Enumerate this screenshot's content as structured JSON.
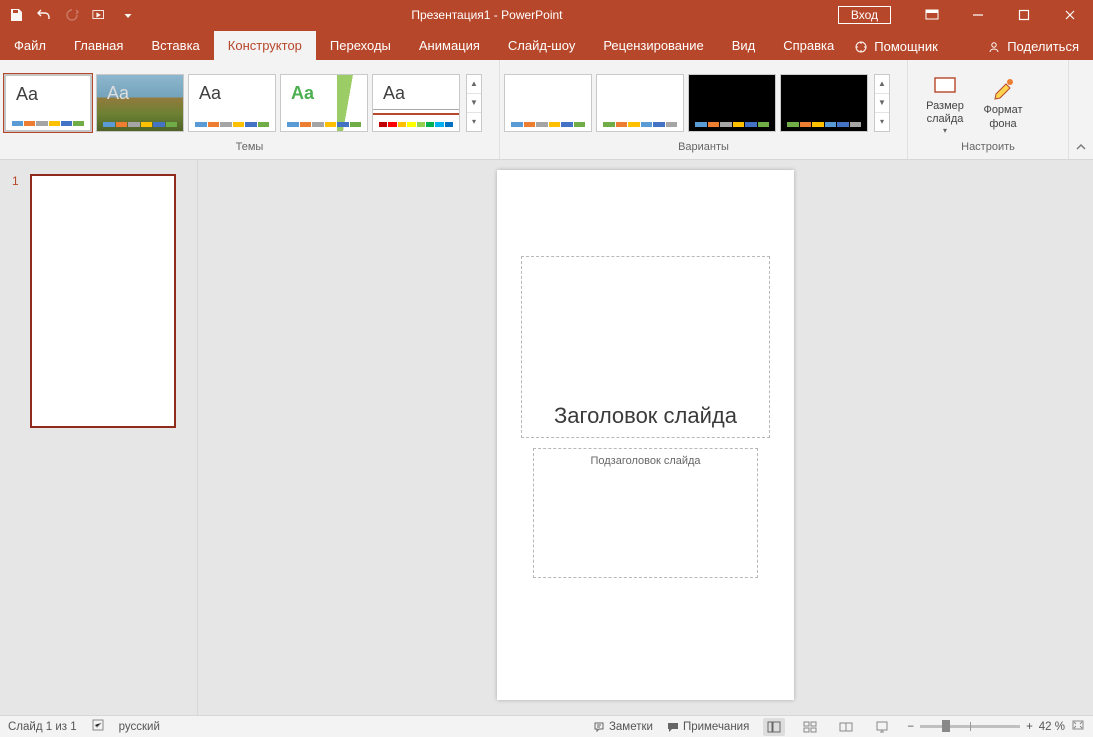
{
  "titlebar": {
    "title": "Презентация1 - PowerPoint",
    "signin": "Вход"
  },
  "tabs": {
    "file": "Файл",
    "home": "Главная",
    "insert": "Вставка",
    "design": "Конструктор",
    "transitions": "Переходы",
    "animations": "Анимация",
    "slideshow": "Слайд-шоу",
    "review": "Рецензирование",
    "view": "Вид",
    "help": "Справка",
    "tell_me": "Помощник",
    "share": "Поделиться"
  },
  "ribbon": {
    "themes_label": "Темы",
    "variants_label": "Варианты",
    "customize_label": "Настроить",
    "slide_size": "Размер слайда",
    "format_bg": "Формат фона",
    "sample_aa": "Aa"
  },
  "slide": {
    "number": "1",
    "title_placeholder": "Заголовок слайда",
    "subtitle_placeholder": "Подзаголовок слайда"
  },
  "status": {
    "slide_counter": "Слайд 1 из 1",
    "language": "русский",
    "notes": "Заметки",
    "comments": "Примечания",
    "zoom_value": "42 %"
  }
}
